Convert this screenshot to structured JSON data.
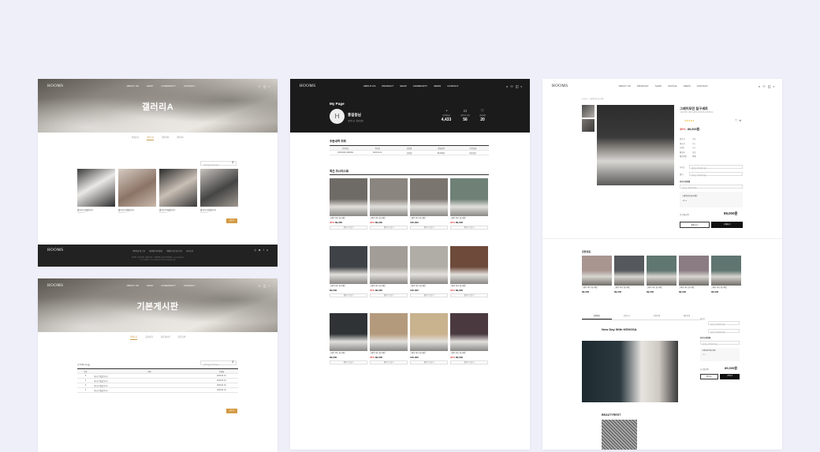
{
  "brand": "HOOMS",
  "gallery": {
    "title": "갤러리A",
    "nav": [
      "ABOUT US",
      "SHOP",
      "COMMUNITY",
      "CONTACT"
    ],
    "tabs": [
      "전체보기",
      "갤러리A",
      "갤러리B",
      "갤러리C"
    ],
    "search_placeholder": "검색어를 입력하세요",
    "items": [
      {
        "name": "갤러리 1 샘플입니다",
        "meta": "2023.01.01"
      },
      {
        "name": "갤러리 2 샘플입니다",
        "meta": "2023.01.01"
      },
      {
        "name": "갤러리 3 샘플입니다",
        "meta": "2023.01.01"
      },
      {
        "name": "갤러리 4 샘플입니다",
        "meta": "2023.01.01"
      }
    ],
    "write_label": "글쓰기",
    "footer_links": [
      "이용약관 및 고지",
      "개인정보처리방침",
      "이메일 무단수집 거부",
      "회사소개"
    ],
    "footer_info": "회사명 : 후즈 대표 : 홍길동 주소 : 서울특별시 강남구 전화번호 : 02-1234-5678",
    "footer_copy": "COPYRIGHT © HOOMS ALL RIGHTS RESERVED"
  },
  "board": {
    "title": "기본게시판",
    "tabs": [
      "전체보기",
      "공지사항",
      "자유게시판",
      "질문답변"
    ],
    "count_label": "총 5개의 게시물",
    "search_placeholder": "검색어를 입력하세요",
    "columns": [
      "번호",
      "제목",
      "등록일"
    ],
    "rows": [
      {
        "no": "5",
        "title": "게시판 샘플입니다",
        "date": "2023.01.01"
      },
      {
        "no": "4",
        "title": "게시판 샘플입니다",
        "date": "2023.01.01"
      },
      {
        "no": "3",
        "title": "게시판 샘플입니다",
        "date": "2023.01.01"
      },
      {
        "no": "2",
        "title": "게시판 샘플입니다",
        "date": "2023.01.01"
      }
    ],
    "write_label": "글쓰기"
  },
  "mypage": {
    "nav": [
      "ABOUT US",
      "PRODUCT",
      "SHOP",
      "COMMUNITY",
      "NEWS",
      "CONTACT"
    ],
    "title": "My Page",
    "avatar_letter": "H",
    "user_name": "홍길동님",
    "user_meta": "회원등급 : 일반회원",
    "stats": [
      {
        "label": "보유적립금",
        "value": "4,433"
      },
      {
        "label": "사용가능쿠폰",
        "value": "56"
      },
      {
        "label": "관심상품",
        "value": "20"
      }
    ],
    "order_title": "주문내역 조회",
    "order_columns": [
      "주문번호",
      "주문일",
      "상품명",
      "결제금액",
      "주문상태"
    ],
    "order_row": [
      "20230101-0000001",
      "2023.01.01",
      "상품명",
      "89,000원",
      "배송완료"
    ],
    "recent_title": "최근 위시리스트",
    "products": [
      {
        "name": "그레이 미니 침구세트",
        "price": "89,000",
        "sale": "30%",
        "color": "#6e6a66"
      },
      {
        "name": "그레이 미니 침구세트",
        "price": "89,000",
        "sale": "30%",
        "color": "#8a857e"
      },
      {
        "name": "그레이 미니 침구세트",
        "price": "120,000",
        "sale": "",
        "color": "#7b7570"
      },
      {
        "name": "그레이 미니 침구세트",
        "price": "89,000",
        "sale": "30%",
        "color": "#6f8077"
      },
      {
        "name": "그레이 미니 침구세트",
        "price": "89,000",
        "sale": "",
        "color": "#3f4347"
      },
      {
        "name": "그레이 미니 침구세트",
        "price": "89,000",
        "sale": "30%",
        "color": "#a29d96"
      },
      {
        "name": "그레이 미니 침구세트",
        "price": "120,000",
        "sale": "",
        "color": "#b0aca6"
      },
      {
        "name": "그레이 미니 침구세트",
        "price": "89,000",
        "sale": "30%",
        "color": "#6d4a3a"
      },
      {
        "name": "그레이 미니 침구세트",
        "price": "89,000",
        "sale": "",
        "color": "#2f3336"
      },
      {
        "name": "그레이 미니 침구세트",
        "price": "89,000",
        "sale": "30%",
        "color": "#b49a7c"
      },
      {
        "name": "그레이 미니 침구세트",
        "price": "120,000",
        "sale": "",
        "color": "#c9b28e"
      },
      {
        "name": "그레이 미니 침구세트",
        "price": "89,000",
        "sale": "30%",
        "color": "#4a3a40"
      }
    ],
    "cart_label": "장바구니 담기"
  },
  "product": {
    "nav": [
      "ABOUT US",
      "PRODUCT",
      "SHOP",
      "NOTICE",
      "NEWS",
      "CONTACT"
    ],
    "breadcrumb": "HOME > 그레이모던 침구세트",
    "name": "그레이모던 침구세트",
    "desc": "고급스러운 그레이 컬러의 모던한 침구세트입니다.",
    "rating": "★★★★★",
    "sale": "30%",
    "price": "89,000원",
    "info_rows": [
      {
        "k": "원산지",
        "v": "국산"
      },
      {
        "k": "제조사",
        "v": "후즈"
      },
      {
        "k": "브랜드",
        "v": "후즈"
      },
      {
        "k": "배송비",
        "v": "무료"
      },
      {
        "k": "배송방법",
        "v": "택배"
      }
    ],
    "options": [
      {
        "k": "사이즈",
        "v": "옵션을 선택해주세요"
      },
      {
        "k": "컬러",
        "v": "옵션을 선택해주세요"
      }
    ],
    "addon_label": "추가구성상품",
    "selected_item": "그레이모던 침구세트",
    "total_label": "총 상품금액",
    "total": "89,000원",
    "cart_btn": "장바구니",
    "buy_btn": "구매하기",
    "related_title": "관련상품",
    "related": [
      {
        "name": "그레이 미니 침구세트",
        "price": "89,000",
        "color": "#a89590"
      },
      {
        "name": "그레이 미니 침구세트",
        "price": "89,000",
        "color": "#55585c"
      },
      {
        "name": "그레이 미니 침구세트",
        "price": "89,000",
        "color": "#607670"
      },
      {
        "name": "그레이 미니 침구세트",
        "price": "89,000",
        "color": "#8a7c82"
      },
      {
        "name": "그레이 미니 침구세트",
        "price": "89,000",
        "color": "#5f7570"
      }
    ],
    "detail_tabs": [
      "상품정보",
      "상품후기",
      "상품문의",
      "배송안내"
    ],
    "detail_heading": "New Day With KENOSA",
    "detail_heading2": "BEAUTYREST"
  },
  "colors": {
    "accent": "#d39a42",
    "sale": "#d94040",
    "dark": "#1b1b1b"
  }
}
